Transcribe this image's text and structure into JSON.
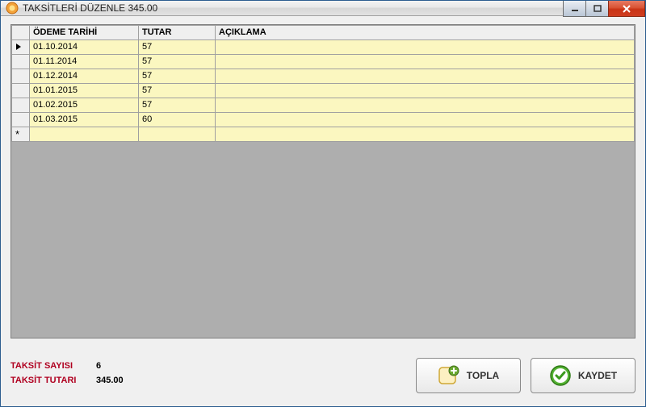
{
  "window": {
    "title": "TAKSİTLERİ DÜZENLE 345.00"
  },
  "grid": {
    "headers": {
      "date": "ÖDEME TARİHİ",
      "amount": "TUTAR",
      "desc": "AÇIKLAMA"
    },
    "rows": [
      {
        "date": "01.10.2014",
        "amount": "57",
        "desc": ""
      },
      {
        "date": "01.11.2014",
        "amount": "57",
        "desc": ""
      },
      {
        "date": "01.12.2014",
        "amount": "57",
        "desc": ""
      },
      {
        "date": "01.01.2015",
        "amount": "57",
        "desc": ""
      },
      {
        "date": "01.02.2015",
        "amount": "57",
        "desc": ""
      },
      {
        "date": "01.03.2015",
        "amount": "60",
        "desc": ""
      }
    ]
  },
  "footer": {
    "count_label": "TAKSİT SAYISI",
    "count_value": "6",
    "total_label": "TAKSİT TUTARI",
    "total_value": "345.00",
    "sum_button": "TOPLA",
    "save_button": "KAYDET"
  }
}
